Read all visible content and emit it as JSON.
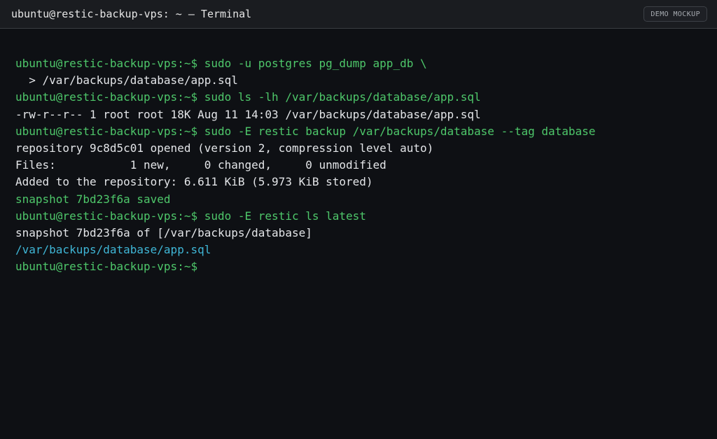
{
  "window": {
    "title": "ubuntu@restic-backup-vps: ~ — Terminal",
    "badge": "DEMO MOCKUP"
  },
  "colors": {
    "background": "#0e1014",
    "titlebar": "#1a1c20",
    "prompt_green": "#4ec76a",
    "path_cyan": "#3fb6d6",
    "output_white": "#e3e5e8"
  },
  "terminal": {
    "lines": [
      {
        "text": "ubuntu@restic-backup-vps:~$ sudo -u postgres pg_dump app_db \\",
        "color": "green"
      },
      {
        "text": "  > /var/backups/database/app.sql",
        "color": "white"
      },
      {
        "text": "ubuntu@restic-backup-vps:~$ sudo ls -lh /var/backups/database/app.sql",
        "color": "green"
      },
      {
        "text": "-rw-r--r-- 1 root root 18K Aug 11 14:03 /var/backups/database/app.sql",
        "color": "white"
      },
      {
        "text": "ubuntu@restic-backup-vps:~$ sudo -E restic backup /var/backups/database --tag database",
        "color": "green"
      },
      {
        "text": "repository 9c8d5c01 opened (version 2, compression level auto)",
        "color": "white"
      },
      {
        "text": "Files:           1 new,     0 changed,     0 unmodified",
        "color": "white"
      },
      {
        "text": "Added to the repository: 6.611 KiB (5.973 KiB stored)",
        "color": "white"
      },
      {
        "text": "snapshot 7bd23f6a saved",
        "color": "green"
      },
      {
        "text": "ubuntu@restic-backup-vps:~$ sudo -E restic ls latest",
        "color": "green"
      },
      {
        "text": "snapshot 7bd23f6a of [/var/backups/database]",
        "color": "white"
      },
      {
        "text": "/var/backups/database/app.sql",
        "color": "cyan"
      },
      {
        "text": "ubuntu@restic-backup-vps:~$",
        "color": "green"
      }
    ]
  }
}
